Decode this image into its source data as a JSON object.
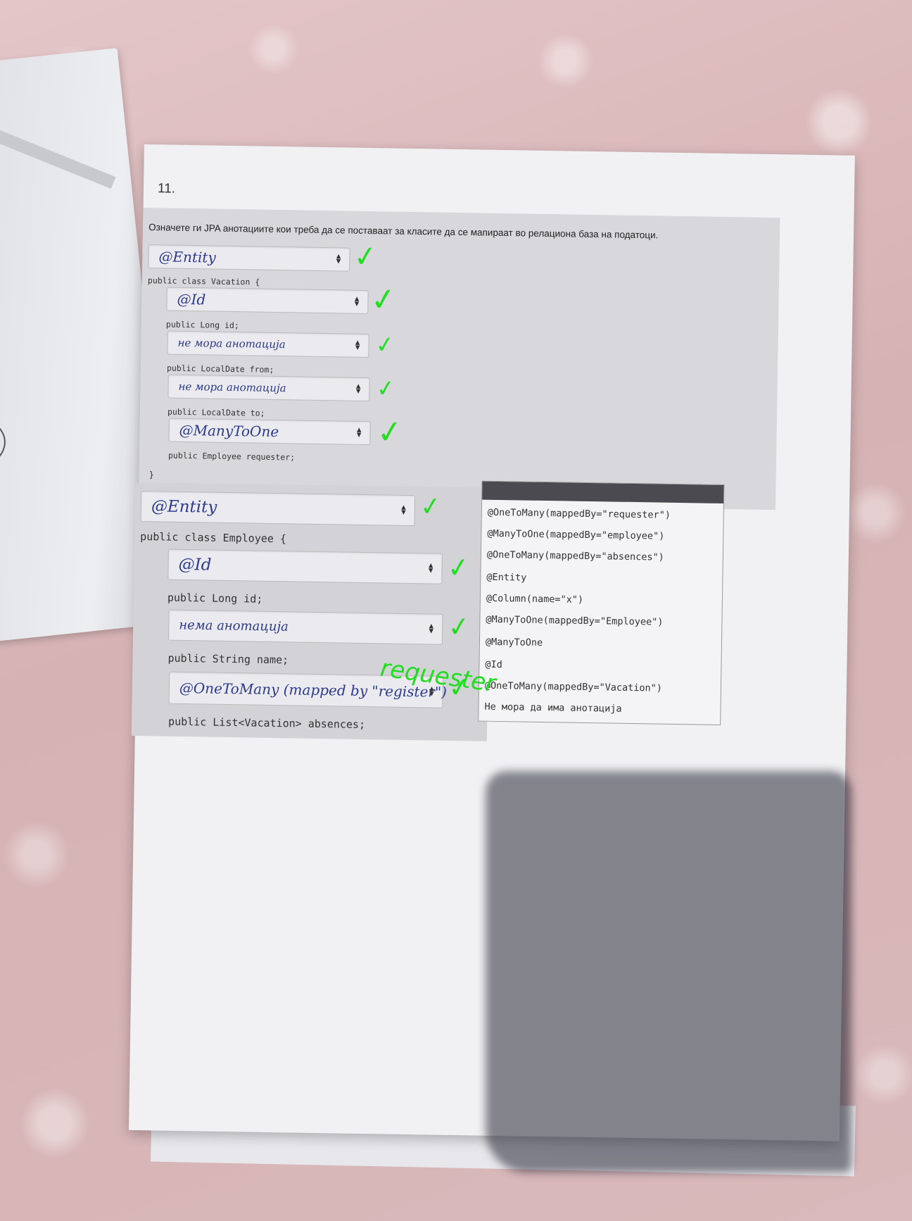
{
  "question_number": "11.",
  "prompt": "Означете ги JPA анотациите кои треба да се поставаат за класите да се мапираат во релациона база на податоци.",
  "vacation_class": {
    "class_decl": "public class Vacation {",
    "entity_answer": "@Entity",
    "fields": [
      {
        "answer": "@Id",
        "decl": "public Long id;"
      },
      {
        "answer": "не мора анотација",
        "decl": "public LocalDate from;"
      },
      {
        "answer": "не мора анотација",
        "decl": "public LocalDate to;"
      },
      {
        "answer": "@ManyToOne",
        "decl": "public Employee requester;"
      }
    ],
    "closing": "}"
  },
  "employee_class": {
    "entity_answer": "@Entity",
    "class_decl": "public class Employee {",
    "fields": [
      {
        "answer": "@Id",
        "decl": "public Long id;"
      },
      {
        "answer": "нема анотација",
        "decl": "public String name;"
      },
      {
        "answer": "@OneToMany (mapped by \"register\")",
        "decl": "public List<Vacation> absences;"
      }
    ]
  },
  "options": [
    "@OneToMany(mappedBy=\"requester\")",
    "@ManyToOne(mappedBy=\"employee\")",
    "@OneToMany(mappedBy=\"absences\")",
    "@Entity",
    "@Column(name=\"x\")",
    "@ManyToOne(mappedBy=\"Employee\")",
    "@ManyToOne",
    "@Id",
    "@OneToMany(mappedBy=\"Vacation\")",
    "Не мора да има анотација"
  ],
  "check_mark": "✓",
  "correction_note": "requester",
  "colors": {
    "check_green": "#22dd22",
    "handwriting_blue": "#2b3a8a"
  }
}
